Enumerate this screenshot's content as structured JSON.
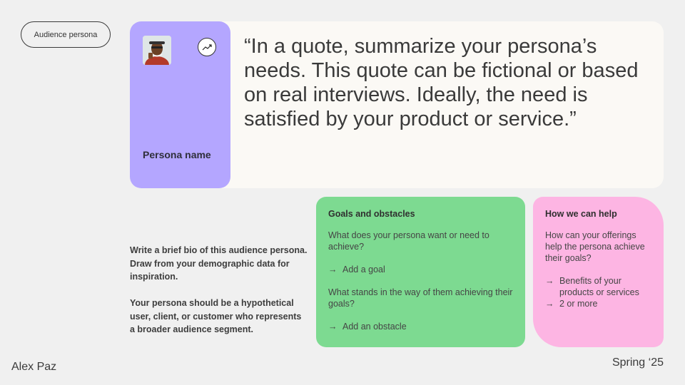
{
  "tag": {
    "label": "Audience persona"
  },
  "persona": {
    "name": "Persona name",
    "avatar_icon": "person-photo-icon",
    "trend_icon": "trending-up-icon"
  },
  "quote": "“In a quote, summarize your persona’s needs. This quote can be fictional or based on real interviews. Ideally, the need is satisfied by your product or service.”",
  "bio": {
    "paragraph1": "Write a brief bio of this audience persona. Draw from your demographic data for inspiration.",
    "paragraph2": "Your persona should be a hypothetical user, client, or customer who represents a broader audience segment."
  },
  "goals": {
    "title": "Goals and obstacles",
    "question1": "What does your persona want or need to achieve?",
    "item1": "Add a goal",
    "question2": "What stands in the way of them achieving their goals?",
    "item2": "Add an obstacle"
  },
  "help": {
    "title": "How we can help",
    "question": "How can your offerings help the persona achieve their goals?",
    "item1": "Benefits of your products or services",
    "item2": "2 or more"
  },
  "arrow": "→",
  "footer": {
    "author": "Alex Paz",
    "season": "Spring ‘25"
  },
  "colors": {
    "persona_card": "#b4a6ff",
    "quote_card": "#fbf9f5",
    "goals_card": "#7dda91",
    "help_card": "#fdb5e3",
    "background": "#f0f0f0"
  }
}
